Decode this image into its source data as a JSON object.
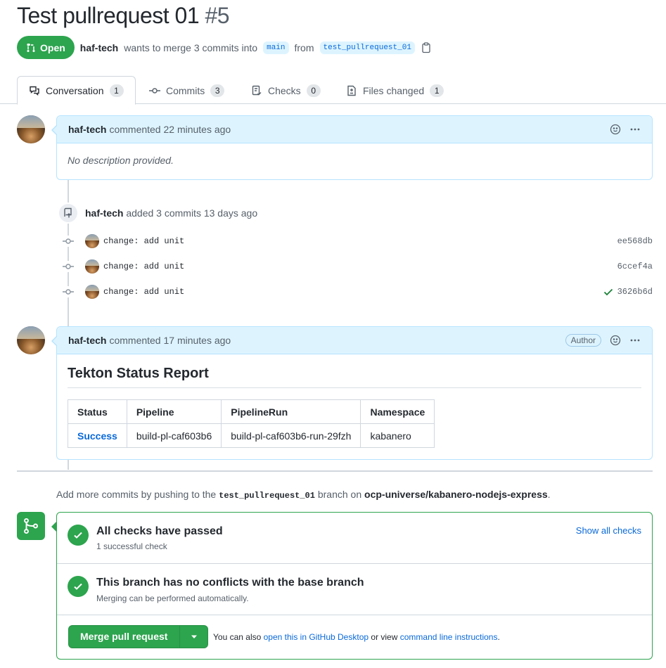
{
  "header": {
    "title": "Test pullrequest 01",
    "number": "#5",
    "state": "Open",
    "author": "haf-tech",
    "merge_text": "wants to merge 3 commits into",
    "base_branch": "main",
    "from_text": "from",
    "head_branch": "test_pullrequest_01"
  },
  "tabs": [
    {
      "label": "Conversation",
      "count": "1"
    },
    {
      "label": "Commits",
      "count": "3"
    },
    {
      "label": "Checks",
      "count": "0"
    },
    {
      "label": "Files changed",
      "count": "1"
    }
  ],
  "comment1": {
    "author": "haf-tech",
    "meta": "commented 22 minutes ago",
    "body": "No description provided."
  },
  "commit_event": {
    "author": "haf-tech",
    "text": "added 3 commits 13 days ago",
    "commits": [
      {
        "message": "change: add unit",
        "sha": "ee568db"
      },
      {
        "message": "change: add unit",
        "sha": "6ccef4a"
      },
      {
        "message": "change: add unit",
        "sha": "3626b6d"
      }
    ]
  },
  "comment2": {
    "author": "haf-tech",
    "meta": "commented 17 minutes ago",
    "role": "Author",
    "heading": "Tekton Status Report",
    "table": {
      "headers": [
        "Status",
        "Pipeline",
        "PipelineRun",
        "Namespace"
      ],
      "row": [
        "Success",
        "build-pl-caf603b6",
        "build-pl-caf603b6-run-29fzh",
        "kabanero"
      ]
    }
  },
  "hint": {
    "prefix": "Add more commits by pushing to the",
    "branch": "test_pullrequest_01",
    "middle": "branch on",
    "repo": "ocp-universe/kabanero-nodejs-express",
    "suffix": "."
  },
  "merge": {
    "checks_title": "All checks have passed",
    "checks_sub": "1 successful check",
    "show_checks": "Show all checks",
    "conflict_title": "This branch has no conflicts with the base branch",
    "conflict_sub": "Merging can be performed automatically.",
    "button": "Merge pull request",
    "also_prefix": "You can also",
    "desktop_link": "open this in GitHub Desktop",
    "or_view": "or view",
    "cli_link": "command line instructions",
    "period": "."
  },
  "colors": {
    "green": "#2da44e",
    "blue": "#0969da",
    "comment_header": "#ddf4ff"
  }
}
